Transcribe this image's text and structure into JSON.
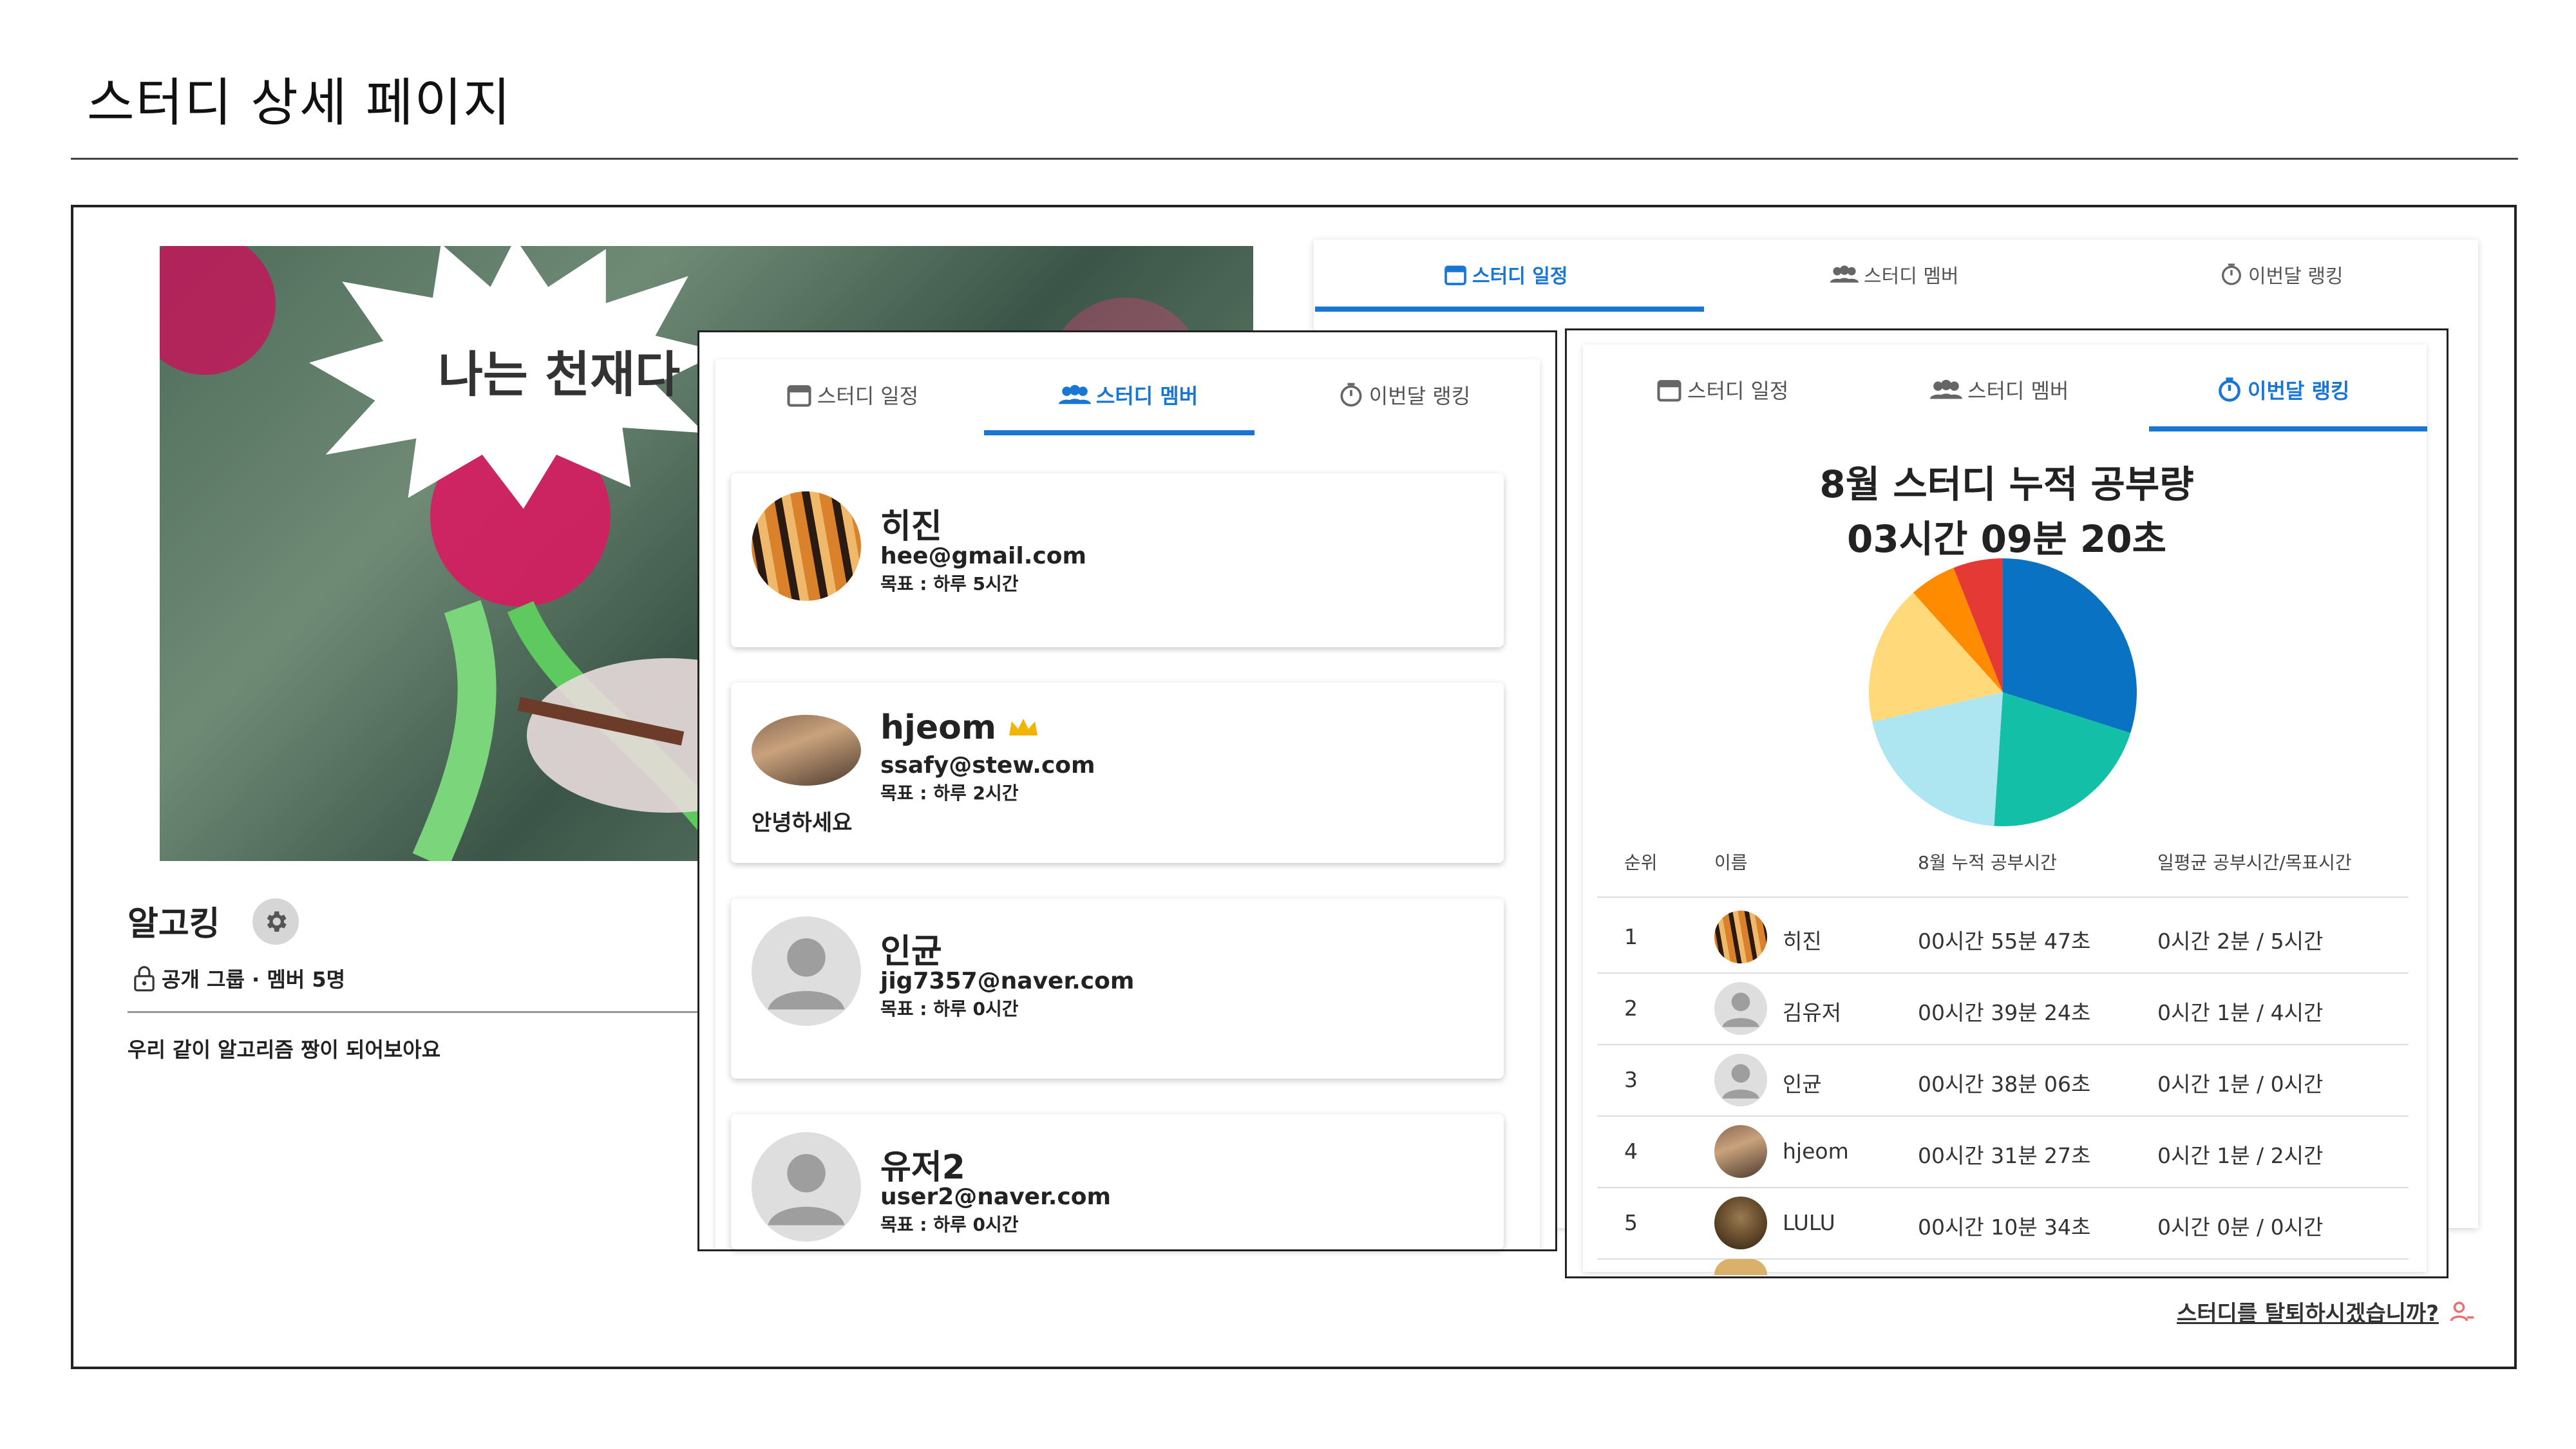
{
  "slide_title": "스터디 상세 페이지",
  "hero": {
    "burst_text": "나는 천재다"
  },
  "study": {
    "name": "알고킹",
    "meta": "공개 그룹 · 멤버 5명",
    "description": "우리 같이 알고리즘 짱이 되어보아요"
  },
  "tabs": {
    "schedule": "스터디 일정",
    "members": "스터디 멤버",
    "ranking": "이번달 랭킹"
  },
  "members": [
    {
      "name": "히진",
      "email": "hee@gmail.com",
      "goal": "목표 : 하루 5시간",
      "message": "",
      "avatar": "tiger"
    },
    {
      "name": "hjeom",
      "email": "ssafy@stew.com",
      "goal": "목표 : 하루 2시간",
      "message": "안녕하세요",
      "avatar": "photo",
      "leader": true
    },
    {
      "name": "인균",
      "email": "jig7357@naver.com",
      "goal": "목표 : 하루 0시간",
      "message": "",
      "avatar": "default"
    },
    {
      "name": "유저2",
      "email": "user2@naver.com",
      "goal": "목표 : 하루 0시간",
      "message": "",
      "avatar": "default"
    }
  ],
  "ranking": {
    "title": "8월 스터디 누적 공부량",
    "total": "03시간 09분 20초",
    "columns": [
      "순위",
      "이름",
      "8월 누적 공부시간",
      "일평균 공부시간/목표시간"
    ],
    "rows": [
      {
        "rank": "1",
        "name": "히진",
        "total": "00시간 55분 47초",
        "avg": "0시간 2분 / 5시간",
        "avatar": "tiger"
      },
      {
        "rank": "2",
        "name": "김유저",
        "total": "00시간 39분 24초",
        "avg": "0시간 1분 / 4시간",
        "avatar": "default"
      },
      {
        "rank": "3",
        "name": "인균",
        "total": "00시간 38분 06초",
        "avg": "0시간 1분 / 0시간",
        "avatar": "default"
      },
      {
        "rank": "4",
        "name": "hjeom",
        "total": "00시간 31분 27초",
        "avg": "0시간 1분 / 2시간",
        "avatar": "photo"
      },
      {
        "rank": "5",
        "name": "LULU",
        "total": "00시간 10분 34초",
        "avg": "0시간 0분 / 0시간",
        "avatar": "cat"
      }
    ]
  },
  "chart_data": {
    "type": "pie",
    "categories": [
      "히진",
      "김유저",
      "인균",
      "hjeom",
      "LULU"
    ],
    "values": [
      3347,
      2364,
      2286,
      1887,
      634
    ],
    "colors": [
      "#0a72c2",
      "#13bfa6",
      "#ade6f0",
      "#ffd97a",
      "#ff8c00",
      "#e53935"
    ],
    "extra_slice": 0.06
  },
  "colors": {
    "accent": "#1976d2",
    "crown": "#f2b400",
    "leave_icon": "#e57373"
  },
  "leave_label": "스터디를 탈퇴하시겠습니까?"
}
